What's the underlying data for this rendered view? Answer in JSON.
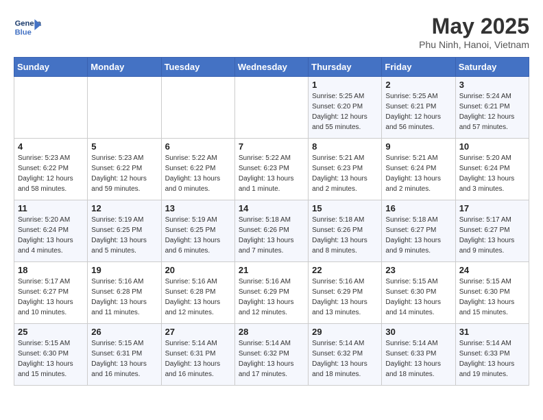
{
  "header": {
    "logo_line1": "General",
    "logo_line2": "Blue",
    "month": "May 2025",
    "location": "Phu Ninh, Hanoi, Vietnam"
  },
  "days_of_week": [
    "Sunday",
    "Monday",
    "Tuesday",
    "Wednesday",
    "Thursday",
    "Friday",
    "Saturday"
  ],
  "weeks": [
    [
      {
        "day": "",
        "info": ""
      },
      {
        "day": "",
        "info": ""
      },
      {
        "day": "",
        "info": ""
      },
      {
        "day": "",
        "info": ""
      },
      {
        "day": "1",
        "info": "Sunrise: 5:25 AM\nSunset: 6:20 PM\nDaylight: 12 hours\nand 55 minutes."
      },
      {
        "day": "2",
        "info": "Sunrise: 5:25 AM\nSunset: 6:21 PM\nDaylight: 12 hours\nand 56 minutes."
      },
      {
        "day": "3",
        "info": "Sunrise: 5:24 AM\nSunset: 6:21 PM\nDaylight: 12 hours\nand 57 minutes."
      }
    ],
    [
      {
        "day": "4",
        "info": "Sunrise: 5:23 AM\nSunset: 6:22 PM\nDaylight: 12 hours\nand 58 minutes."
      },
      {
        "day": "5",
        "info": "Sunrise: 5:23 AM\nSunset: 6:22 PM\nDaylight: 12 hours\nand 59 minutes."
      },
      {
        "day": "6",
        "info": "Sunrise: 5:22 AM\nSunset: 6:22 PM\nDaylight: 13 hours\nand 0 minutes."
      },
      {
        "day": "7",
        "info": "Sunrise: 5:22 AM\nSunset: 6:23 PM\nDaylight: 13 hours\nand 1 minute."
      },
      {
        "day": "8",
        "info": "Sunrise: 5:21 AM\nSunset: 6:23 PM\nDaylight: 13 hours\nand 2 minutes."
      },
      {
        "day": "9",
        "info": "Sunrise: 5:21 AM\nSunset: 6:24 PM\nDaylight: 13 hours\nand 2 minutes."
      },
      {
        "day": "10",
        "info": "Sunrise: 5:20 AM\nSunset: 6:24 PM\nDaylight: 13 hours\nand 3 minutes."
      }
    ],
    [
      {
        "day": "11",
        "info": "Sunrise: 5:20 AM\nSunset: 6:24 PM\nDaylight: 13 hours\nand 4 minutes."
      },
      {
        "day": "12",
        "info": "Sunrise: 5:19 AM\nSunset: 6:25 PM\nDaylight: 13 hours\nand 5 minutes."
      },
      {
        "day": "13",
        "info": "Sunrise: 5:19 AM\nSunset: 6:25 PM\nDaylight: 13 hours\nand 6 minutes."
      },
      {
        "day": "14",
        "info": "Sunrise: 5:18 AM\nSunset: 6:26 PM\nDaylight: 13 hours\nand 7 minutes."
      },
      {
        "day": "15",
        "info": "Sunrise: 5:18 AM\nSunset: 6:26 PM\nDaylight: 13 hours\nand 8 minutes."
      },
      {
        "day": "16",
        "info": "Sunrise: 5:18 AM\nSunset: 6:27 PM\nDaylight: 13 hours\nand 9 minutes."
      },
      {
        "day": "17",
        "info": "Sunrise: 5:17 AM\nSunset: 6:27 PM\nDaylight: 13 hours\nand 9 minutes."
      }
    ],
    [
      {
        "day": "18",
        "info": "Sunrise: 5:17 AM\nSunset: 6:27 PM\nDaylight: 13 hours\nand 10 minutes."
      },
      {
        "day": "19",
        "info": "Sunrise: 5:16 AM\nSunset: 6:28 PM\nDaylight: 13 hours\nand 11 minutes."
      },
      {
        "day": "20",
        "info": "Sunrise: 5:16 AM\nSunset: 6:28 PM\nDaylight: 13 hours\nand 12 minutes."
      },
      {
        "day": "21",
        "info": "Sunrise: 5:16 AM\nSunset: 6:29 PM\nDaylight: 13 hours\nand 12 minutes."
      },
      {
        "day": "22",
        "info": "Sunrise: 5:16 AM\nSunset: 6:29 PM\nDaylight: 13 hours\nand 13 minutes."
      },
      {
        "day": "23",
        "info": "Sunrise: 5:15 AM\nSunset: 6:30 PM\nDaylight: 13 hours\nand 14 minutes."
      },
      {
        "day": "24",
        "info": "Sunrise: 5:15 AM\nSunset: 6:30 PM\nDaylight: 13 hours\nand 15 minutes."
      }
    ],
    [
      {
        "day": "25",
        "info": "Sunrise: 5:15 AM\nSunset: 6:30 PM\nDaylight: 13 hours\nand 15 minutes."
      },
      {
        "day": "26",
        "info": "Sunrise: 5:15 AM\nSunset: 6:31 PM\nDaylight: 13 hours\nand 16 minutes."
      },
      {
        "day": "27",
        "info": "Sunrise: 5:14 AM\nSunset: 6:31 PM\nDaylight: 13 hours\nand 16 minutes."
      },
      {
        "day": "28",
        "info": "Sunrise: 5:14 AM\nSunset: 6:32 PM\nDaylight: 13 hours\nand 17 minutes."
      },
      {
        "day": "29",
        "info": "Sunrise: 5:14 AM\nSunset: 6:32 PM\nDaylight: 13 hours\nand 18 minutes."
      },
      {
        "day": "30",
        "info": "Sunrise: 5:14 AM\nSunset: 6:33 PM\nDaylight: 13 hours\nand 18 minutes."
      },
      {
        "day": "31",
        "info": "Sunrise: 5:14 AM\nSunset: 6:33 PM\nDaylight: 13 hours\nand 19 minutes."
      }
    ]
  ]
}
